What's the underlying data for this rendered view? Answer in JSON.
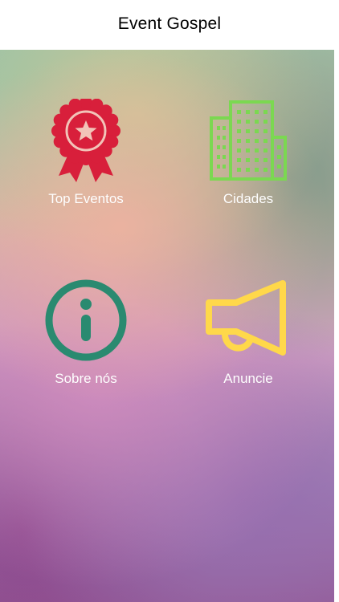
{
  "header": {
    "title": "Event Gospel"
  },
  "menu": {
    "items": [
      {
        "label": "Top Eventos",
        "icon": "award-ribbon-icon",
        "color": "#d81f3b"
      },
      {
        "label": "Cidades",
        "icon": "buildings-icon",
        "color": "#7bd851"
      },
      {
        "label": "Sobre nós",
        "icon": "info-icon",
        "color": "#2a8a70"
      },
      {
        "label": "Anuncie",
        "icon": "megaphone-icon",
        "color": "#ffd84a"
      }
    ]
  }
}
